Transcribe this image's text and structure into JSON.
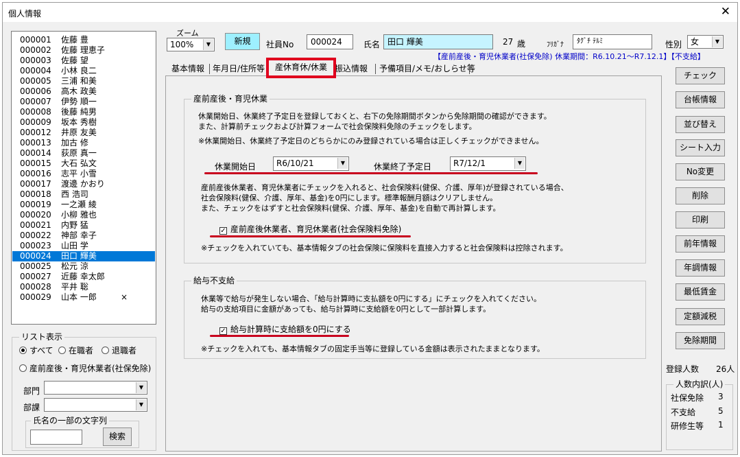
{
  "window": {
    "title": "個人情報",
    "close_glyph": "✕"
  },
  "employees": [
    {
      "no": "000001",
      "name": "佐藤 豊",
      "mark": ""
    },
    {
      "no": "000002",
      "name": "佐藤 理恵子",
      "mark": ""
    },
    {
      "no": "000003",
      "name": "佐藤 望",
      "mark": ""
    },
    {
      "no": "000004",
      "name": "小林 良二",
      "mark": ""
    },
    {
      "no": "000005",
      "name": "三浦 和美",
      "mark": ""
    },
    {
      "no": "000006",
      "name": "高木 政美",
      "mark": ""
    },
    {
      "no": "000007",
      "name": "伊勢 順一",
      "mark": ""
    },
    {
      "no": "000008",
      "name": "後藤 純男",
      "mark": ""
    },
    {
      "no": "000009",
      "name": "坂本 秀樹",
      "mark": ""
    },
    {
      "no": "000012",
      "name": "井原 友美",
      "mark": ""
    },
    {
      "no": "000013",
      "name": "加古 修",
      "mark": ""
    },
    {
      "no": "000014",
      "name": "荻原 真一",
      "mark": ""
    },
    {
      "no": "000015",
      "name": "大石 弘文",
      "mark": ""
    },
    {
      "no": "000016",
      "name": "志平 小雪",
      "mark": ""
    },
    {
      "no": "000017",
      "name": "渡邊 かおり",
      "mark": ""
    },
    {
      "no": "000018",
      "name": "西 浩司",
      "mark": ""
    },
    {
      "no": "000019",
      "name": "一之瀬 綾",
      "mark": ""
    },
    {
      "no": "000020",
      "name": "小柳 雅也",
      "mark": ""
    },
    {
      "no": "000021",
      "name": "内野 猛",
      "mark": ""
    },
    {
      "no": "000022",
      "name": "神部 幸子",
      "mark": ""
    },
    {
      "no": "000023",
      "name": "山田 学",
      "mark": ""
    },
    {
      "no": "000024",
      "name": "田口 輝美",
      "mark": ""
    },
    {
      "no": "000025",
      "name": "松元 涼",
      "mark": ""
    },
    {
      "no": "000027",
      "name": "近藤 幸太郎",
      "mark": ""
    },
    {
      "no": "000028",
      "name": "平井 聡",
      "mark": ""
    },
    {
      "no": "000029",
      "name": "山本 一郎",
      "mark": "×"
    }
  ],
  "selected_index": 21,
  "list_filter": {
    "title": "リスト表示",
    "all": "すべて",
    "active": "在職者",
    "retired": "退職者",
    "leave": "産前産後・育児休業者(社保免除)",
    "dept_label": "部門",
    "section_label": "部課",
    "name_search_title": "氏名の一部の文字列",
    "search_button": "検索"
  },
  "header": {
    "zoom_label": "ズーム",
    "zoom_value": "100%",
    "new_button": "新規",
    "empno_label": "社員No",
    "empno_value": "000024",
    "name_label": "氏名",
    "name_value": "田口 輝美",
    "age_value": "27",
    "age_unit": "歳",
    "furigana_label": "ﾌﾘｶﾞﾅ",
    "furigana_value": "ﾀｸﾞﾁ ﾃﾙﾐ",
    "gender_label": "性別",
    "gender_value": "女",
    "status_line": "【産前産後・育児休業者(社保免除) 休業期間：R6.10.21～R7.12.1】【不支給】"
  },
  "tabs": [
    "基本情報",
    "年月日/住所等",
    "産休育休/休業",
    "振込情報",
    "予備項目/メモ/おしらせ等"
  ],
  "leave": {
    "title": "産前産後・育児休業",
    "desc1": "休業開始日、休業終了予定日を登録しておくと、右下の免除期間ボタンから免除期間の確認ができます。",
    "desc2": "また、計算前チェックおよび計算フォームで社会保険料免除のチェックをします。",
    "desc3": "※休業開始日、休業終了予定日のどちらかにのみ登録されている場合は正しくチェックができません。",
    "start_label": "休業開始日",
    "start_value": "R6/10/21",
    "end_label": "休業終了予定日",
    "end_value": "R7/12/1",
    "note1": "産前産後休業者、育児休業者にチェックを入れると、社会保険料(健保、介護、厚年)が登録されている場合、",
    "note2": "社会保険料(健保、介護、厚年、基金)を0円にします。標準報酬月額はクリアしません。",
    "note3": "また、チェックをはずすと社会保険料(健保、介護、厚年、基金)を自動で再計算します。",
    "checkbox_label": "産前産後休業者、育児休業者(社会保険料免除)",
    "checkbox_note": "※チェックを入れていても、基本情報タブの社会保険に保険料を直接入力すると社会保険料は控除されます。"
  },
  "nopay": {
    "title": "給与不支給",
    "desc1": "休業等で給与が発生しない場合、「給与計算時に支払額を0円にする」にチェックを入れてください。",
    "desc2": "給与の支給項目に金額があっても、給与計算時に支給額を0円として一部計算します。",
    "checkbox_label": "給与計算時に支給額を0円にする",
    "note": "※チェックを入れても、基本情報タブの固定手当等に登録している金額は表示されたままとなります。"
  },
  "right_buttons": [
    "チェック",
    "台帳情報",
    "並び替え",
    "シート入力",
    "No変更",
    "削除",
    "印刷",
    "前年情報",
    "年調情報",
    "最低賃金",
    "定額減税",
    "免除期間"
  ],
  "stats": {
    "registered_label": "登録人数",
    "registered_value": "26人",
    "breakdown_title": "人数内訳(人)",
    "rows": [
      {
        "label": "社保免除",
        "value": "3"
      },
      {
        "label": "不支給",
        "value": "5"
      },
      {
        "label": "研修生等",
        "value": "1"
      }
    ]
  },
  "colors": {
    "accent_blue": "#0000c8",
    "highlight_red": "#c8001e",
    "select_blue": "#0078d7",
    "new_button_bg": "#9ef0ff",
    "name_field_bg": "#c6f4ff"
  }
}
